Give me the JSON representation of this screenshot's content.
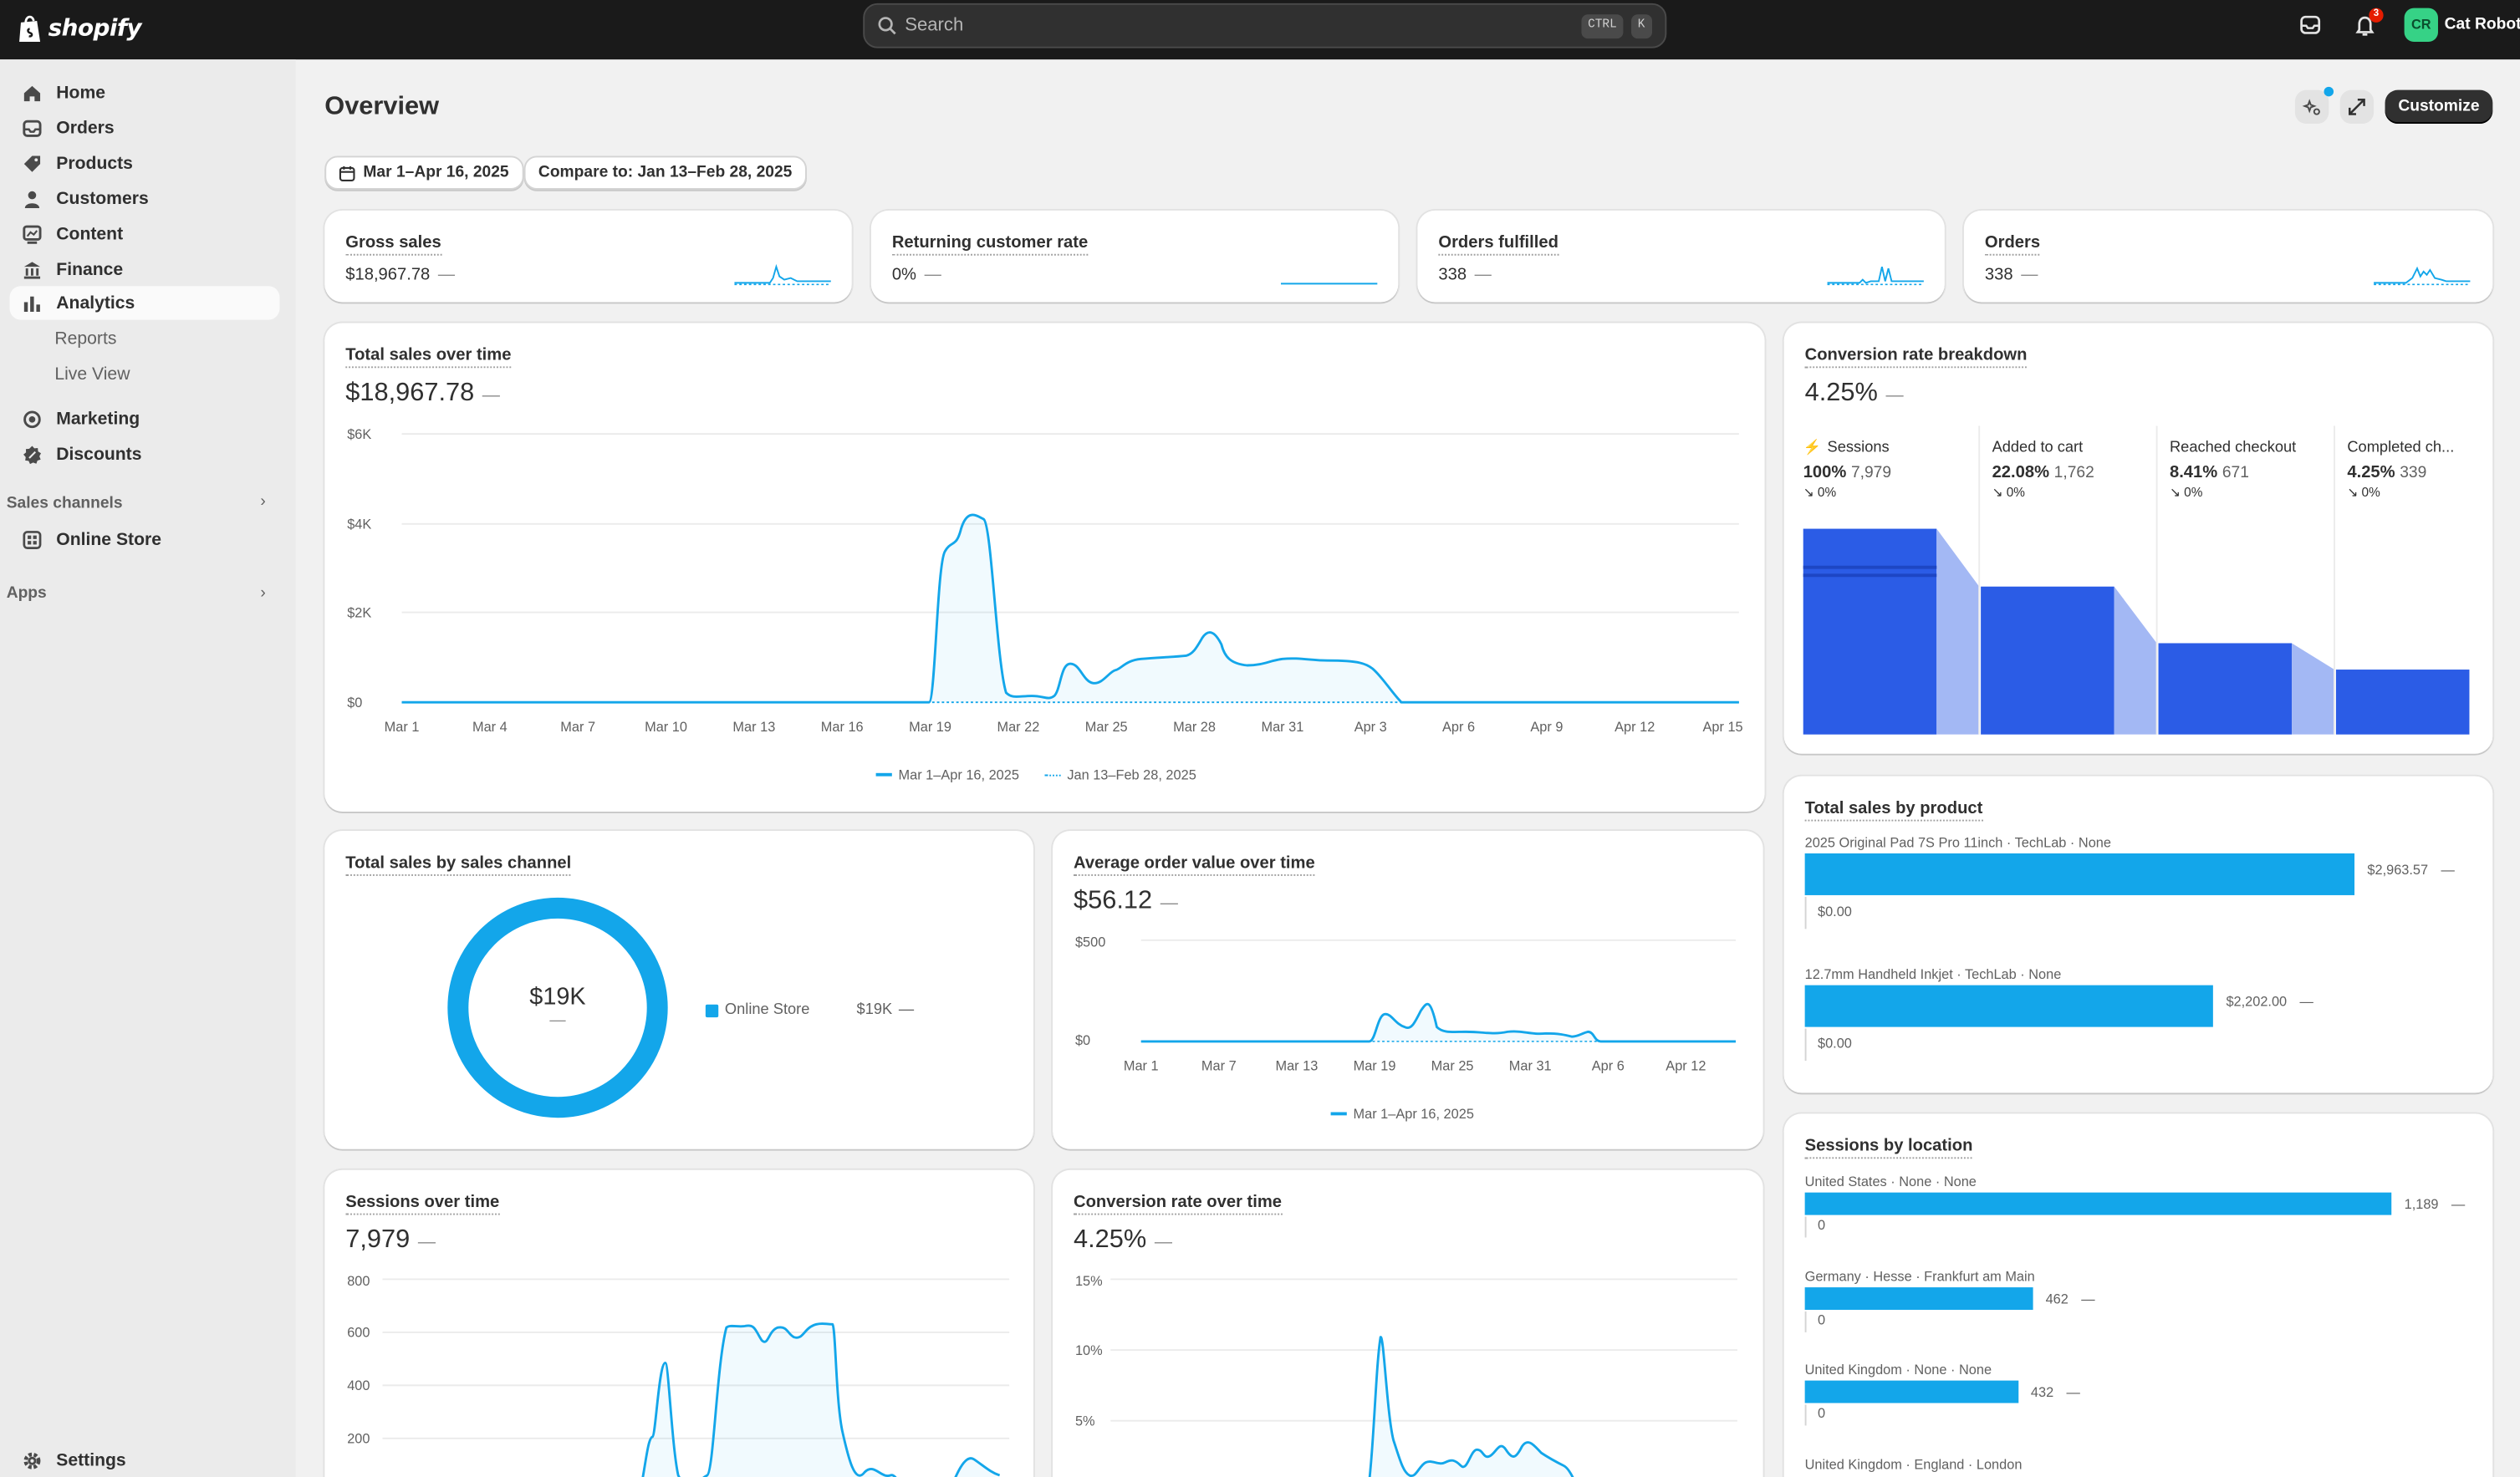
{
  "topbar": {
    "logo_text": "shopify",
    "search_placeholder": "Search",
    "shortcut_key1": "CTRL",
    "shortcut_key2": "K",
    "notification_count": "3",
    "avatar_initials": "CR",
    "store_name": "Cat Robot"
  },
  "sidebar": {
    "items": [
      {
        "label": "Home",
        "icon": "home-icon"
      },
      {
        "label": "Orders",
        "icon": "orders-icon"
      },
      {
        "label": "Products",
        "icon": "tag-icon"
      },
      {
        "label": "Customers",
        "icon": "person-icon"
      },
      {
        "label": "Content",
        "icon": "content-icon"
      },
      {
        "label": "Finance",
        "icon": "bank-icon"
      },
      {
        "label": "Analytics",
        "icon": "bar-chart-icon"
      }
    ],
    "analytics_sub": [
      "Reports",
      "Live View"
    ],
    "items2": [
      {
        "label": "Marketing",
        "icon": "target-icon"
      },
      {
        "label": "Discounts",
        "icon": "discount-icon"
      }
    ],
    "sales_channels_label": "Sales channels",
    "online_store_label": "Online Store",
    "apps_label": "Apps",
    "settings_label": "Settings"
  },
  "page": {
    "title": "Overview",
    "date_range": "Mar 1–Apr 16, 2025",
    "compare": "Compare to: Jan 13–Feb 28, 2025",
    "customize_label": "Customize",
    "dash": "—"
  },
  "kpis": [
    {
      "title": "Gross sales",
      "value": "$18,967.78"
    },
    {
      "title": "Returning customer rate",
      "value": "0%"
    },
    {
      "title": "Orders fulfilled",
      "value": "338"
    },
    {
      "title": "Orders",
      "value": "338"
    }
  ],
  "total_sales": {
    "title": "Total sales over time",
    "value": "$18,967.78",
    "y_ticks": [
      "$6K",
      "$4K",
      "$2K",
      "$0"
    ],
    "x_ticks": [
      "Mar 1",
      "Mar 4",
      "Mar 7",
      "Mar 10",
      "Mar 13",
      "Mar 16",
      "Mar 19",
      "Mar 22",
      "Mar 25",
      "Mar 28",
      "Mar 31",
      "Apr 3",
      "Apr 6",
      "Apr 9",
      "Apr 12",
      "Apr 15"
    ],
    "legend_current": "Mar 1–Apr 16, 2025",
    "legend_compare": "Jan 13–Feb 28, 2025"
  },
  "conversion": {
    "title": "Conversion rate breakdown",
    "value": "4.25%",
    "steps": [
      {
        "label": "Sessions",
        "pct": "100%",
        "count": "7,979",
        "delta": "0%",
        "fraction": 1.0
      },
      {
        "label": "Added to cart",
        "pct": "22.08%",
        "count": "1,762",
        "delta": "0%",
        "fraction": 0.2208
      },
      {
        "label": "Reached checkout",
        "pct": "8.41%",
        "count": "671",
        "delta": "0%",
        "fraction": 0.0841
      },
      {
        "label": "Completed ch...",
        "pct": "4.25%",
        "count": "339",
        "delta": "0%",
        "fraction": 0.0425
      }
    ]
  },
  "channel": {
    "title": "Total sales by sales channel",
    "center_value": "$19K",
    "legend_label": "Online Store",
    "legend_value": "$19K"
  },
  "aov": {
    "title": "Average order value over time",
    "value": "$56.12",
    "y_ticks": [
      "$500",
      "$0"
    ],
    "x_ticks": [
      "Mar 1",
      "Mar 7",
      "Mar 13",
      "Mar 19",
      "Mar 25",
      "Mar 31",
      "Apr 6",
      "Apr 12"
    ],
    "legend": "Mar 1–Apr 16, 2025"
  },
  "by_product": {
    "title": "Total sales by product",
    "items": [
      {
        "name": "2025 Original Pad 7S Pro 11inch · TechLab · None",
        "value": "$2,963.57",
        "compare": "$0.00",
        "amount": 2963.57
      },
      {
        "name": "12.7mm Handheld Inkjet · TechLab · None",
        "value": "$2,202.00",
        "compare": "$0.00",
        "amount": 2202.0
      }
    ]
  },
  "sessions": {
    "title": "Sessions over time",
    "value": "7,979",
    "y_ticks": [
      "800",
      "600",
      "400",
      "200"
    ]
  },
  "conv_time": {
    "title": "Conversion rate over time",
    "value": "4.25%",
    "y_ticks": [
      "15%",
      "10%",
      "5%"
    ]
  },
  "location": {
    "title": "Sessions by location",
    "items": [
      {
        "name": "United States · None · None",
        "value": "1,189",
        "compare": "0",
        "amount": 1189
      },
      {
        "name": "Germany · Hesse · Frankfurt am Main",
        "value": "462",
        "compare": "0",
        "amount": 462
      },
      {
        "name": "United Kingdom · None · None",
        "value": "432",
        "compare": "0",
        "amount": 432
      },
      {
        "name": "United Kingdom · England · London"
      }
    ]
  },
  "colors": {
    "accent": "#13a6ea",
    "funnel": "#2b5ce6",
    "funnel_light": "#a3b8f4",
    "topbar": "#1a1a1a"
  }
}
